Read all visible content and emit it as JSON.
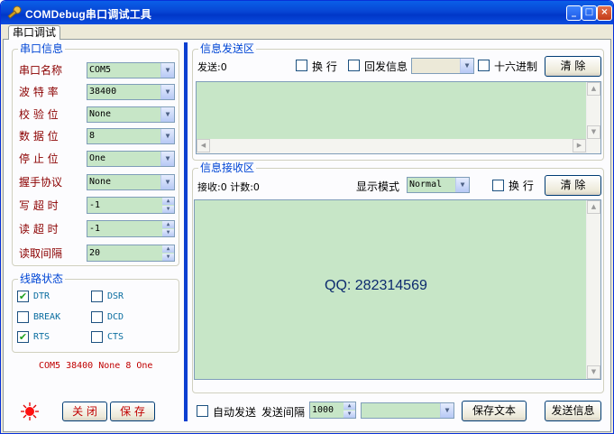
{
  "window": {
    "title": "COMDebug串口调试工具",
    "tab": "串口调试"
  },
  "serial_info": {
    "title": "串口信息",
    "fields": [
      {
        "label": "串口名称",
        "value": "COM5"
      },
      {
        "label": "波 特 率",
        "value": "38400"
      },
      {
        "label": "校 验 位",
        "value": "None"
      },
      {
        "label": "数 据 位",
        "value": "8"
      },
      {
        "label": "停 止 位",
        "value": "One"
      },
      {
        "label": "握手协议",
        "value": "None"
      },
      {
        "label": "写 超 时",
        "value": "-1"
      },
      {
        "label": "读 超 时",
        "value": "-1"
      },
      {
        "label": "读取间隔",
        "value": "20"
      }
    ]
  },
  "line_status": {
    "title": "线路状态",
    "items": [
      {
        "label": "DTR",
        "checked": true
      },
      {
        "label": "DSR",
        "checked": false
      },
      {
        "label": "BREAK",
        "checked": false
      },
      {
        "label": "DCD",
        "checked": false
      },
      {
        "label": "RTS",
        "checked": true
      },
      {
        "label": "CTS",
        "checked": false
      }
    ]
  },
  "status_text": "COM5 38400 None 8 One",
  "bottom_buttons": {
    "close": "关 闭",
    "save": "保 存"
  },
  "send_area": {
    "title": "信息发送区",
    "count": "发送:0",
    "wrap": "换 行",
    "echo": "回发信息",
    "hex": "十六进制",
    "clear": "清 除"
  },
  "receive_area": {
    "title": "信息接收区",
    "count": "接收:0 计数:0",
    "mode_label": "显示模式",
    "mode_value": "Normal",
    "wrap": "换 行",
    "clear": "清 除",
    "content": "QQ: 282314569"
  },
  "footer": {
    "auto_send": "自动发送",
    "interval_label": "发送间隔",
    "interval_value": "1000",
    "save_text": "保存文本",
    "send_info": "发送信息"
  },
  "colors": {
    "field_bg": "#c7e6c7",
    "title_blue": "#0046d5",
    "label_red": "#8b0000"
  }
}
